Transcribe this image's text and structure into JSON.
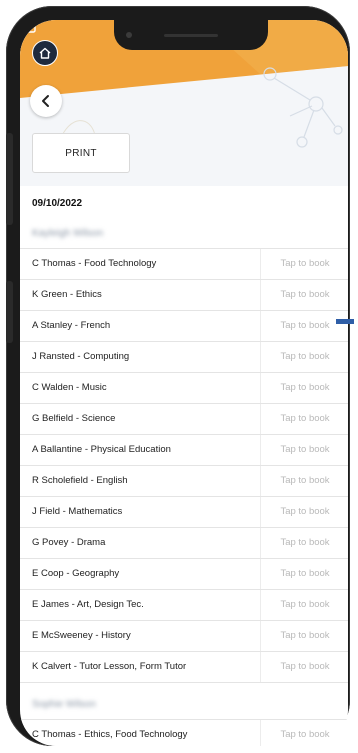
{
  "header": {
    "print_label": "PRINT"
  },
  "session": {
    "date": "09/10/2022"
  },
  "students": [
    {
      "name": "Kayleigh Wilson",
      "appointments": [
        {
          "teacher": "C Thomas - Food Technology",
          "action": "Tap to book"
        },
        {
          "teacher": "K Green - Ethics",
          "action": "Tap to book"
        },
        {
          "teacher": "A Stanley - French",
          "action": "Tap to book"
        },
        {
          "teacher": "J Ransted - Computing",
          "action": "Tap to book"
        },
        {
          "teacher": "C Walden - Music",
          "action": "Tap to book"
        },
        {
          "teacher": "G Belfield - Science",
          "action": "Tap to book"
        },
        {
          "teacher": "A Ballantine - Physical Education",
          "action": "Tap to book"
        },
        {
          "teacher": "R Scholefield - English",
          "action": "Tap to book"
        },
        {
          "teacher": "J Field - Mathematics",
          "action": "Tap to book"
        },
        {
          "teacher": "G Povey - Drama",
          "action": "Tap to book"
        },
        {
          "teacher": "E Coop - Geography",
          "action": "Tap to book"
        },
        {
          "teacher": "E James - Art, Design Tec.",
          "action": "Tap to book"
        },
        {
          "teacher": "E McSweeney - History",
          "action": "Tap to book"
        },
        {
          "teacher": "K Calvert - Tutor Lesson, Form Tutor",
          "action": "Tap to book"
        }
      ]
    },
    {
      "name": "Sophie Wilson",
      "appointments": [
        {
          "teacher": "C Thomas - Ethics, Food Technology",
          "action": "Tap to book"
        }
      ]
    }
  ],
  "icons": {
    "home": "home-icon",
    "back": "chevron-left-icon",
    "mail": "mail-icon"
  },
  "colors": {
    "header_orange": "#f0a23a",
    "home_button": "#1f2a3d",
    "book_text": "#b9b9b9",
    "connector": "#2f5ea7"
  }
}
